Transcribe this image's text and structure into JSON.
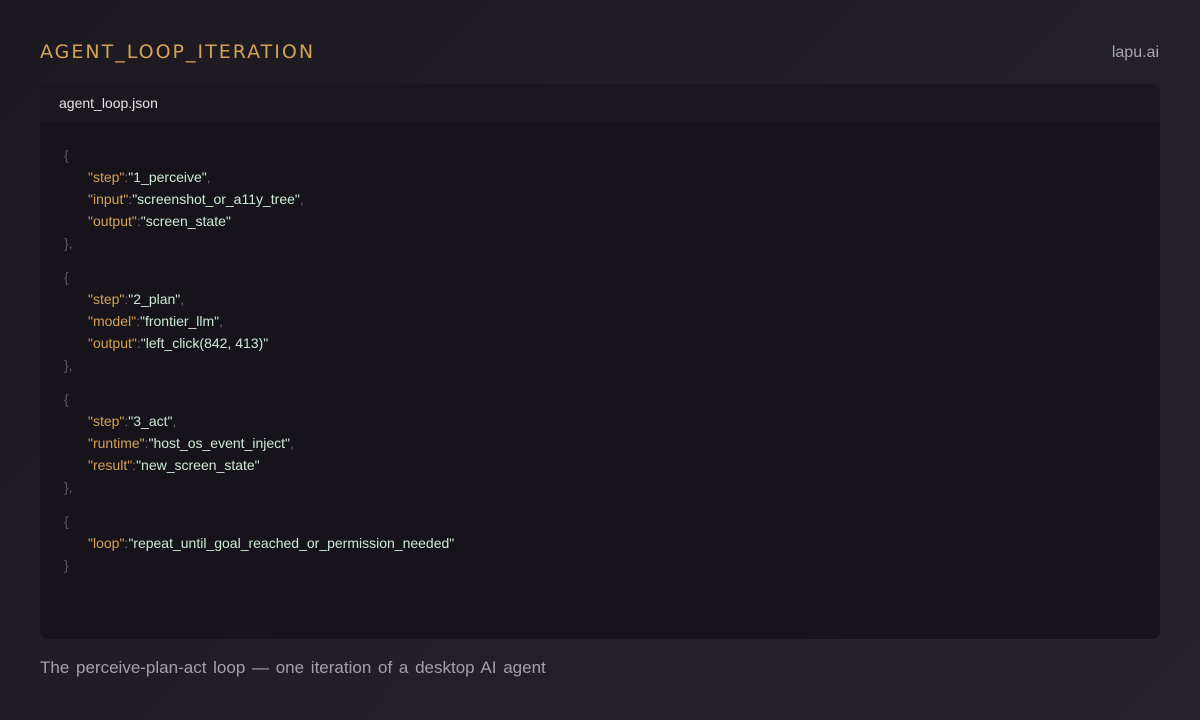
{
  "header": {
    "title": "AGENT_LOOP_ITERATION",
    "brand": "lapu.ai"
  },
  "code": {
    "filename": "agent_loop.json",
    "blocks": [
      {
        "open": "{",
        "lines": [
          {
            "key": "\"step\"",
            "colon": ":",
            "value": "\"1_perceive\"",
            "comma": ","
          },
          {
            "key": "\"input\"",
            "colon": ":",
            "value": "\"screenshot_or_a11y_tree\"",
            "comma": ","
          },
          {
            "key": "\"output\"",
            "colon": ":",
            "value": "\"screen_state\"",
            "comma": ""
          }
        ],
        "close": "},"
      },
      {
        "open": "{",
        "lines": [
          {
            "key": "\"step\"",
            "colon": ":",
            "value": "\"2_plan\"",
            "comma": ","
          },
          {
            "key": "\"model\"",
            "colon": ":",
            "value": "\"frontier_llm\"",
            "comma": ","
          },
          {
            "key": "\"output\"",
            "colon": ":",
            "value": "\"left_click(842, 413)\"",
            "comma": ""
          }
        ],
        "close": "},"
      },
      {
        "open": "{",
        "lines": [
          {
            "key": "\"step\"",
            "colon": ":",
            "value": "\"3_act\"",
            "comma": ","
          },
          {
            "key": "\"runtime\"",
            "colon": ":",
            "value": "\"host_os_event_inject\"",
            "comma": ","
          },
          {
            "key": "\"result\"",
            "colon": ":",
            "value": "\"new_screen_state\"",
            "comma": ""
          }
        ],
        "close": "},"
      },
      {
        "open": "{",
        "lines": [
          {
            "key": "\"loop\"",
            "colon": ":",
            "value": "\"repeat_until_goal_reached_or_permission_needed\"",
            "comma": ""
          }
        ],
        "close": "}"
      }
    ]
  },
  "caption": "The perceive-plan-act  loop — one iteration  of a desktop  AI agent"
}
